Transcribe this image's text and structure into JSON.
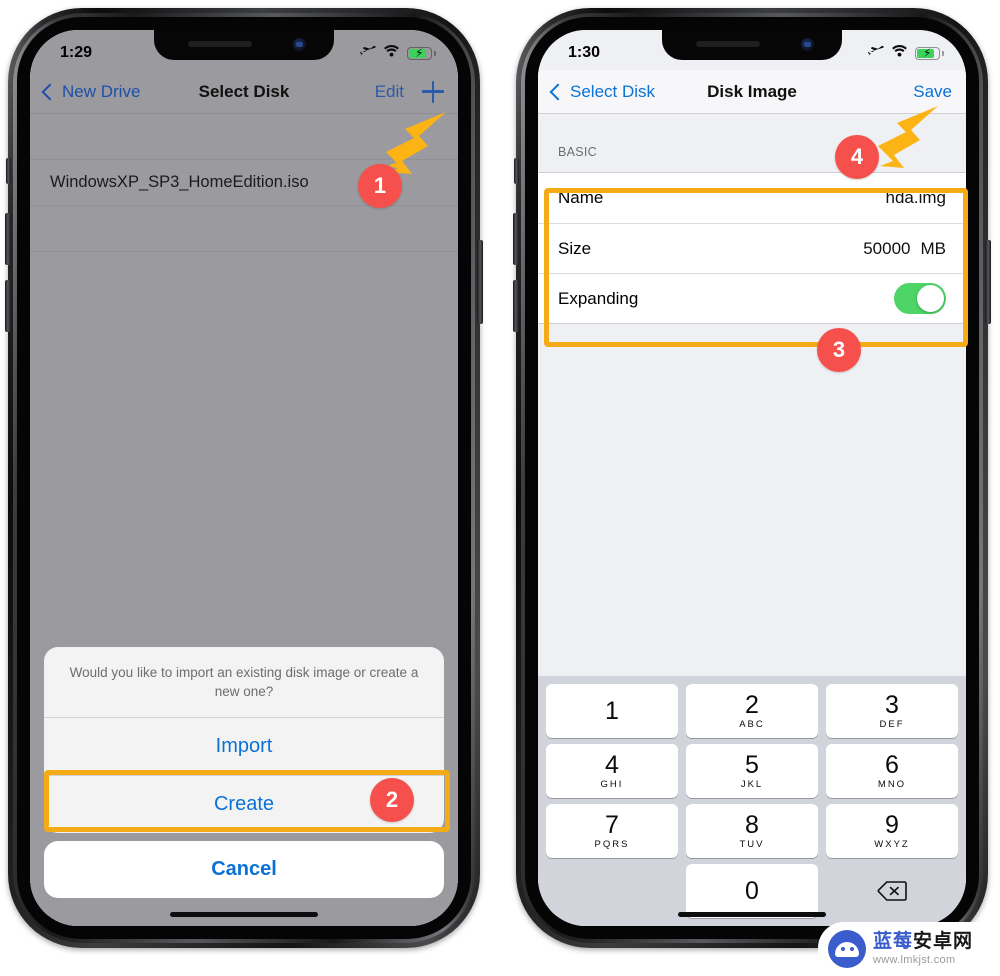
{
  "left_phone": {
    "status_bar": {
      "time": "1:29",
      "icons": [
        "airplane-mode-icon",
        "wifi-icon",
        "battery-charging-icon"
      ]
    },
    "nav": {
      "back_label": "New Drive",
      "title": "Select Disk",
      "edit_label": "Edit",
      "add_label": "+"
    },
    "list": {
      "items": [
        {
          "label": "WindowsXP_SP3_HomeEdition.iso"
        }
      ]
    },
    "action_sheet": {
      "message": "Would you like to import an existing disk image or create a new one?",
      "import_label": "Import",
      "create_label": "Create",
      "cancel_label": "Cancel"
    }
  },
  "right_phone": {
    "status_bar": {
      "time": "1:30",
      "icons": [
        "airplane-mode-icon",
        "wifi-icon",
        "battery-charging-icon"
      ]
    },
    "nav": {
      "back_label": "Select Disk",
      "title": "Disk Image",
      "save_label": "Save"
    },
    "section_header": "BASIC",
    "form": {
      "name_label": "Name",
      "name_value": "hda.img",
      "size_label": "Size",
      "size_value": "50000",
      "size_unit": "MB",
      "expanding_label": "Expanding",
      "expanding_on": true
    },
    "keypad": {
      "keys": [
        {
          "num": "1",
          "letters": ""
        },
        {
          "num": "2",
          "letters": "ABC"
        },
        {
          "num": "3",
          "letters": "DEF"
        },
        {
          "num": "4",
          "letters": "GHI"
        },
        {
          "num": "5",
          "letters": "JKL"
        },
        {
          "num": "6",
          "letters": "MNO"
        },
        {
          "num": "7",
          "letters": "PQRS"
        },
        {
          "num": "8",
          "letters": "TUV"
        },
        {
          "num": "9",
          "letters": "WXYZ"
        },
        {
          "num": "0",
          "letters": ""
        }
      ],
      "delete_icon": "backspace-icon"
    }
  },
  "annotations": {
    "badges": [
      {
        "number": "1"
      },
      {
        "number": "2"
      },
      {
        "number": "3"
      },
      {
        "number": "4"
      }
    ],
    "badge_color": "#F5504C",
    "highlight_color": "#F5AB16",
    "arrow_color": "#FBB414"
  },
  "watermark": {
    "name_blue": "蓝莓",
    "name_dark": "安卓网",
    "url": "www.lmkjst.com"
  }
}
